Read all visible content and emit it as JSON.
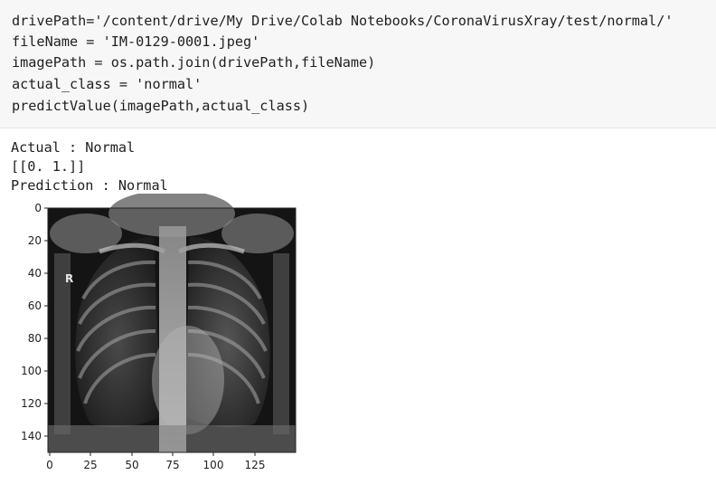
{
  "code_cell": {
    "lines": [
      "drivePath='/content/drive/My Drive/Colab Notebooks/CoronaVirusXray/test/normal/'",
      "fileName = 'IM-0129-0001.jpeg'",
      "imagePath = os.path.join(drivePath,fileName)",
      "actual_class = 'normal'",
      "predictValue(imagePath,actual_class)"
    ]
  },
  "output": {
    "actual": "Actual : Normal",
    "array": "[[0. 1.]]",
    "prediction": "Prediction : Normal"
  },
  "image_plot": {
    "y_ticks": [
      "0",
      "20",
      "40",
      "60",
      "80",
      "100",
      "120",
      "140"
    ],
    "x_ticks": [
      "0",
      "25",
      "50",
      "75",
      "100",
      "125"
    ],
    "marker": "R"
  }
}
